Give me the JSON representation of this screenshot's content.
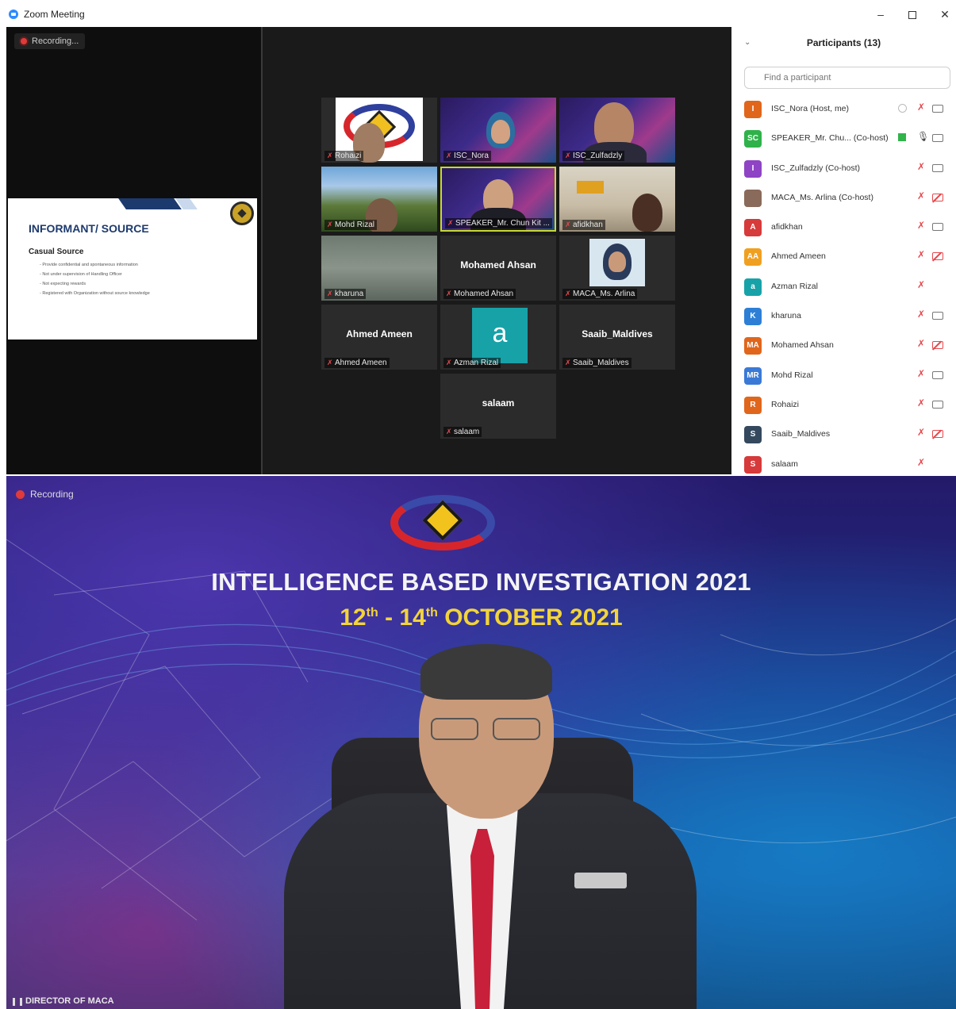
{
  "window": {
    "title": "Zoom Meeting",
    "minimize": "–",
    "close": "✕"
  },
  "share": {
    "recording_label": "Recording...",
    "slide": {
      "title": "INFORMANT/ SOURCE",
      "subtitle": "Casual Source",
      "bullets": [
        "- Provide confidential and spontaneous information",
        "- Not under supervision of Handling Officer",
        "- Not expecting rewards",
        "- Registered with Organization without source knowledge"
      ]
    }
  },
  "gallery": [
    {
      "name": "Rohaizi",
      "big": ""
    },
    {
      "name": "ISC_Nora",
      "big": ""
    },
    {
      "name": "ISC_Zulfadzly",
      "big": ""
    },
    {
      "name": "Mohd Rizal",
      "big": ""
    },
    {
      "name": "SPEAKER_Mr. Chun Kit ...",
      "big": ""
    },
    {
      "name": "afidkhan",
      "big": ""
    },
    {
      "name": "kharuna",
      "big": ""
    },
    {
      "name": "Mohamed Ahsan",
      "big": "Mohamed Ahsan"
    },
    {
      "name": "MACA_Ms. Arlina",
      "big": ""
    },
    {
      "name": "Ahmed Ameen",
      "big": "Ahmed Ameen"
    },
    {
      "name": "Azman Rizal",
      "big": "a"
    },
    {
      "name": "Saaib_Maldives",
      "big": "Saaib_Maldives"
    },
    {
      "name": "salaam",
      "big": "salaam"
    }
  ],
  "participants": {
    "title": "Participants (13)",
    "search_placeholder": "Find a participant",
    "list": [
      {
        "initials": "I",
        "color": "#e0661c",
        "name": "ISC_Nora (Host, me)",
        "mic": "muted",
        "cam": "on",
        "extra": "rec"
      },
      {
        "initials": "SC",
        "color": "#2fb24a",
        "name": "SPEAKER_Mr. Chu...  (Co-host)",
        "mic": "on",
        "cam": "on",
        "extra": "screen"
      },
      {
        "initials": "I",
        "color": "#8e44c4",
        "name": "ISC_Zulfadzly (Co-host)",
        "mic": "muted",
        "cam": "on",
        "extra": ""
      },
      {
        "initials": "",
        "color": "#8a6a5a",
        "name": "MACA_Ms. Arlina (Co-host)",
        "mic": "muted",
        "cam": "off",
        "extra": ""
      },
      {
        "initials": "A",
        "color": "#d63a3a",
        "name": "afidkhan",
        "mic": "muted",
        "cam": "on",
        "extra": ""
      },
      {
        "initials": "AA",
        "color": "#f0a020",
        "name": "Ahmed Ameen",
        "mic": "muted",
        "cam": "off",
        "extra": ""
      },
      {
        "initials": "a",
        "color": "#17a2a8",
        "name": "Azman Rizal",
        "mic": "muted",
        "cam": "",
        "extra": ""
      },
      {
        "initials": "K",
        "color": "#2d7fd6",
        "name": "kharuna",
        "mic": "muted",
        "cam": "on",
        "extra": ""
      },
      {
        "initials": "MA",
        "color": "#e0661c",
        "name": "Mohamed Ahsan",
        "mic": "muted",
        "cam": "off",
        "extra": ""
      },
      {
        "initials": "MR",
        "color": "#3a7ad6",
        "name": "Mohd Rizal",
        "mic": "muted",
        "cam": "on",
        "extra": ""
      },
      {
        "initials": "R",
        "color": "#e0661c",
        "name": "Rohaizi",
        "mic": "muted",
        "cam": "on",
        "extra": ""
      },
      {
        "initials": "S",
        "color": "#34495e",
        "name": "Saaib_Maldives",
        "mic": "muted",
        "cam": "off",
        "extra": ""
      },
      {
        "initials": "S",
        "color": "#d63a3a",
        "name": "salaam",
        "mic": "muted",
        "cam": "",
        "extra": ""
      }
    ]
  },
  "presentation": {
    "recording_label": "Recording",
    "title": "INTELLIGENCE BASED INVESTIGATION 2021",
    "date_d1": "12",
    "date_sup1": "th",
    "date_mid": " - 14",
    "date_sup2": "th",
    "date_tail": " OCTOBER 2021",
    "speaker_label": "DIRECTOR OF MACA"
  }
}
